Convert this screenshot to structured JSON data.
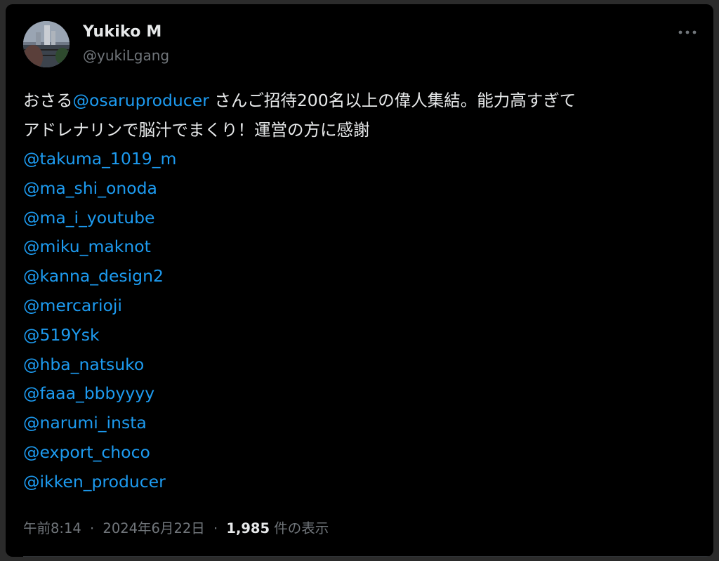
{
  "post": {
    "author": {
      "name": "Yukiko M",
      "handle": "@yukiLgang"
    },
    "text": {
      "line1_prefix": "おさる",
      "line1_mention": "@osaruproducer",
      "line1_suffix": " さんご招待200名以上の偉人集結。能力高すぎて",
      "line2": "アドレナリンで脳汁でまくり！運営の方に感謝"
    },
    "mentions": [
      "@takuma_1019_m",
      "@ma_shi_onoda",
      "@ma_i_youtube",
      "@miku_maknot",
      "@kanna_design2",
      "@mercarioji",
      "@519Ysk",
      "@hba_natsuko",
      "@faaa_bbbyyyy",
      "@narumi_insta",
      "@export_choco",
      "@ikken_producer"
    ],
    "meta": {
      "time": "午前8:14",
      "separator": "·",
      "date": "2024年6月22日",
      "views_count": "1,985",
      "views_label": "件の表示"
    }
  },
  "colors": {
    "background": "#000000",
    "text": "#e7e9ea",
    "muted": "#71767b",
    "link": "#1d9bf0"
  },
  "icons": {
    "more": "more-horizontal-icon"
  }
}
